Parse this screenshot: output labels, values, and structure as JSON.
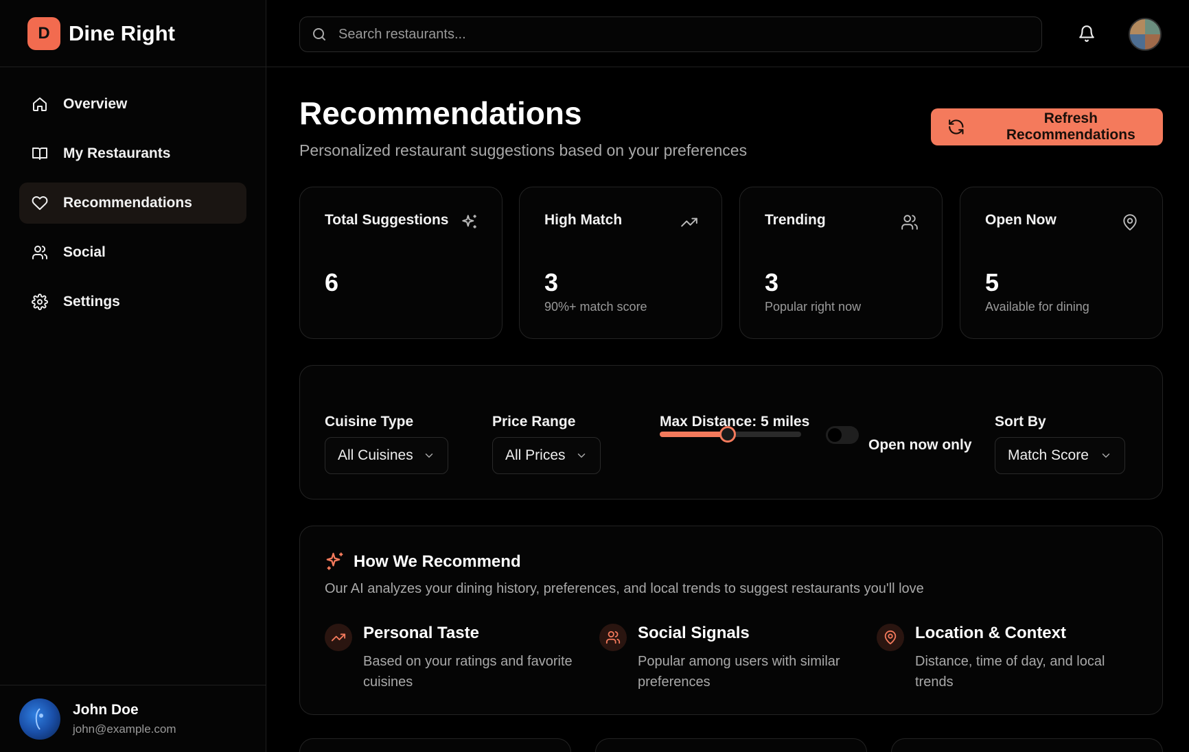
{
  "brand": {
    "badge": "D",
    "name": "Dine Right"
  },
  "nav": [
    {
      "label": "Overview",
      "icon": "home-icon"
    },
    {
      "label": "My Restaurants",
      "icon": "book-icon"
    },
    {
      "label": "Recommendations",
      "icon": "heart-icon",
      "active": true
    },
    {
      "label": "Social",
      "icon": "users-icon"
    },
    {
      "label": "Settings",
      "icon": "gear-icon"
    }
  ],
  "user": {
    "name": "John Doe",
    "email": "john@example.com"
  },
  "search": {
    "placeholder": "Search restaurants..."
  },
  "header": {
    "title": "Recommendations",
    "subtitle": "Personalized restaurant suggestions based on your preferences",
    "refresh_label": "Refresh Recommendations"
  },
  "stats": [
    {
      "title": "Total Suggestions",
      "value": "6",
      "sub": "",
      "icon": "sparkles-icon"
    },
    {
      "title": "High Match",
      "value": "3",
      "sub": "90%+ match score",
      "icon": "trending-up-icon"
    },
    {
      "title": "Trending",
      "value": "3",
      "sub": "Popular right now",
      "icon": "users-icon"
    },
    {
      "title": "Open Now",
      "value": "5",
      "sub": "Available for dining",
      "icon": "map-pin-icon"
    }
  ],
  "filters": {
    "cuisine_label": "Cuisine Type",
    "cuisine_value": "All Cuisines",
    "price_label": "Price Range",
    "price_value": "All Prices",
    "distance_label": "Max Distance: 5 miles",
    "distance_fraction": 0.48,
    "open_now_label": "Open now only",
    "open_now_checked": false,
    "sort_label": "Sort By",
    "sort_value": "Match Score"
  },
  "how": {
    "title": "How We Recommend",
    "description": "Our AI analyzes your dining history, preferences, and local trends to suggest restaurants you'll love",
    "features": [
      {
        "title": "Personal Taste",
        "desc": "Based on your ratings and favorite cuisines",
        "icon": "trending-up-icon"
      },
      {
        "title": "Social Signals",
        "desc": "Popular among users with similar preferences",
        "icon": "users-icon"
      },
      {
        "title": "Location & Context",
        "desc": "Distance, time of day, and local trends",
        "icon": "map-pin-icon"
      }
    ]
  },
  "colors": {
    "accent": "#f47a5c",
    "background": "#000000",
    "card": "#050505"
  }
}
